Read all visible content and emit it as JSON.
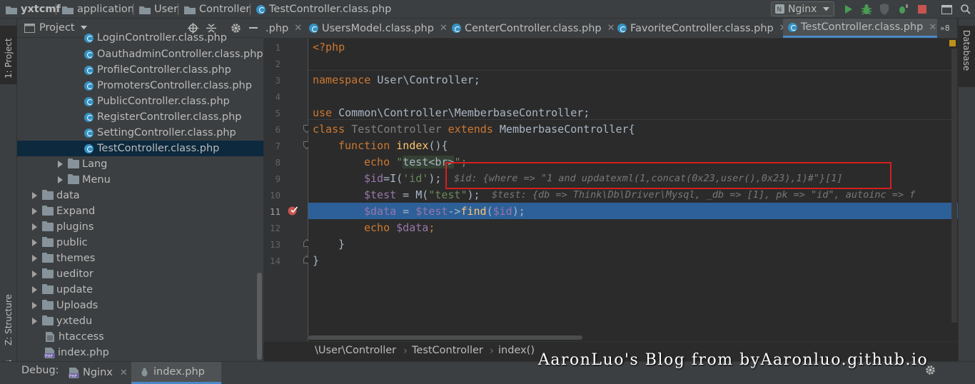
{
  "navbar": {
    "breadcrumbs": [
      "yxtcmf",
      "application",
      "User",
      "Controller",
      "TestController.class.php"
    ],
    "run_config": "Nginx"
  },
  "left_stripe": {
    "project_label": "1: Project",
    "structure_label": "Z: Structure",
    "favorites_label": "orites"
  },
  "project_panel": {
    "title": "Project",
    "tree": [
      {
        "label": "LoginController.class.php",
        "type": "php-class"
      },
      {
        "label": "OauthadminController.class.php",
        "type": "php-class"
      },
      {
        "label": "ProfileController.class.php",
        "type": "php-class"
      },
      {
        "label": "PromotersController.class.php",
        "type": "php-class"
      },
      {
        "label": "PublicController.class.php",
        "type": "php-class"
      },
      {
        "label": "RegisterController.class.php",
        "type": "php-class"
      },
      {
        "label": "SettingController.class.php",
        "type": "php-class"
      },
      {
        "label": "TestController.class.php",
        "type": "php-class",
        "selected": true
      },
      {
        "label": "Lang",
        "type": "folder"
      },
      {
        "label": "Menu",
        "type": "folder"
      },
      {
        "label": "data",
        "type": "folder"
      },
      {
        "label": "Expand",
        "type": "folder"
      },
      {
        "label": "plugins",
        "type": "folder"
      },
      {
        "label": "public",
        "type": "folder"
      },
      {
        "label": "themes",
        "type": "folder"
      },
      {
        "label": "ueditor",
        "type": "folder"
      },
      {
        "label": "update",
        "type": "folder"
      },
      {
        "label": "Uploads",
        "type": "folder"
      },
      {
        "label": "yxtedu",
        "type": "folder"
      },
      {
        "label": "htaccess",
        "type": "file"
      },
      {
        "label": "index.php",
        "type": "php-file"
      }
    ]
  },
  "tabs": [
    {
      "label": ".php"
    },
    {
      "label": "UsersModel.class.php"
    },
    {
      "label": "CenterController.class.php"
    },
    {
      "label": "FavoriteController.class.php"
    },
    {
      "label": "TestController.class.php",
      "active": true
    }
  ],
  "tab_overflow": "»8",
  "right_stripe": {
    "database_label": "Database"
  },
  "editor": {
    "line_numbers": [
      "1",
      "2",
      "3",
      "4",
      "5",
      "6",
      "7",
      "8",
      "9",
      "10",
      "11",
      "12",
      "13",
      "14"
    ],
    "current_line": "11",
    "inline_values": {
      "id": "$id: {where => \"1 and updatexml(1,concat(0x23,user(),0x23),1)#\"}[1]",
      "test": "$test: {db => Think\\Db\\Driver\\Mysql, _db => [1], pk => \"id\", autoinc => f"
    },
    "tokens": {
      "php_open": "<?php",
      "namespace_kw": "namespace",
      "namespace_name": "User\\Controller;",
      "use_kw": "use",
      "use_name": "Common\\Controller\\MemberbaseController;",
      "class_kw": "class",
      "class_name": "TestController",
      "extends_kw": "extends",
      "parent_name": "MemberbaseController{",
      "function_kw": "function",
      "function_name": "index",
      "function_rest": "(){",
      "echo_kw": "echo",
      "echo_str_q": "\"",
      "echo_str_text": "test<br>",
      "echo_str_end": "\";",
      "id_var": "$id",
      "id_assign": "=I(",
      "id_arg": "'id'",
      "id_end": ");",
      "test_var": "$test",
      "test_assign": " = M(",
      "test_arg": "\"test\"",
      "test_end": ");",
      "data_var": "$data",
      "data_assign": " = ",
      "data_test_var": "$test",
      "data_arrow": "->",
      "data_find": "find",
      "data_paren": "(",
      "data_id_var": "$id",
      "data_end": ");",
      "echo2_kw": "echo",
      "echo2_var": "$data",
      "echo2_end": ";",
      "close_method": "}",
      "close_class": "}"
    }
  },
  "editor_breadcrumb": [
    "\\User\\Controller",
    "TestController",
    "index()"
  ],
  "debug": {
    "label": "Debug:",
    "tabs": [
      "Nginx",
      "index.php"
    ]
  },
  "watermark": "AaronLuo's Blog from byAaronluo.github.io"
}
